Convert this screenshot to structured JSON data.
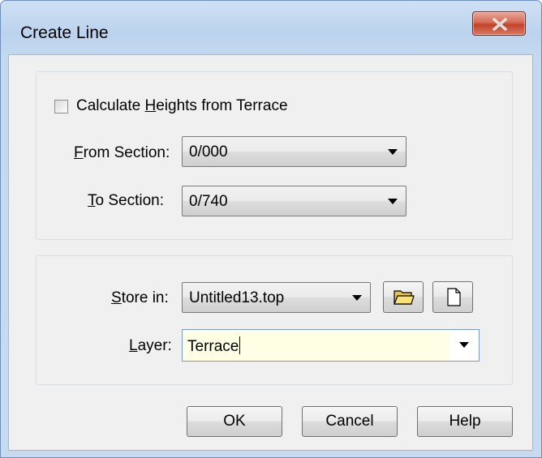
{
  "window": {
    "title": "Create Line"
  },
  "options": {
    "calc_heights": {
      "label_pre": "Calculate ",
      "label_mnemonic": "H",
      "label_post": "eights from Terrace",
      "checked": false
    }
  },
  "from_section": {
    "label_mnemonic": "F",
    "label_post": "rom Section:",
    "value": "0/000"
  },
  "to_section": {
    "label_mnemonic": "T",
    "label_post": "o Section:",
    "value": "0/740"
  },
  "store_in": {
    "label_mnemonic": "S",
    "label_post": "tore in:",
    "value": "Untitled13.top",
    "browse_icon": "folder-icon",
    "new_icon": "new-document-icon"
  },
  "layer": {
    "label_mnemonic": "L",
    "label_post": "ayer:",
    "value": "Terrace"
  },
  "buttons": {
    "ok": "OK",
    "cancel": "Cancel",
    "help": "Help"
  },
  "colors": {
    "layer_field_bg": "#ffffe6",
    "close_button": "#c2432c"
  }
}
